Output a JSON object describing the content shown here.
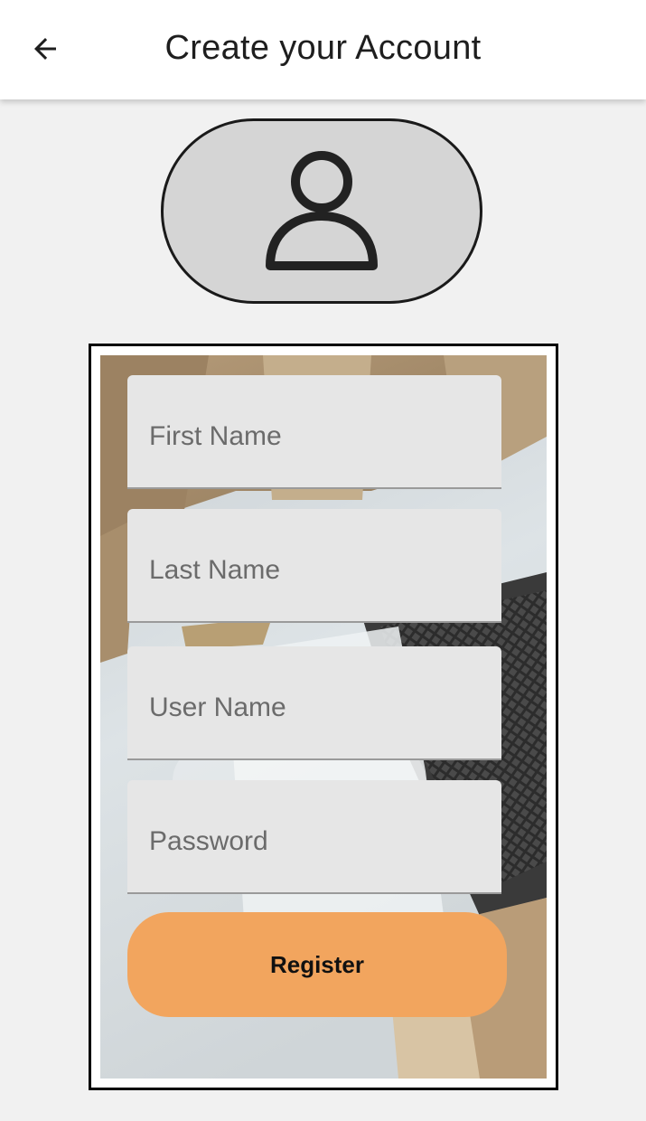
{
  "app_bar": {
    "back_icon": "arrow-left-icon",
    "title": "Create your Account"
  },
  "avatar": {
    "icon": "person-outline-icon"
  },
  "form": {
    "fields": [
      {
        "label": "First Name"
      },
      {
        "label": "Last Name"
      },
      {
        "label": "User Name"
      },
      {
        "label": "Password"
      }
    ],
    "register_label": "Register"
  },
  "colors": {
    "background": "#f1f1f1",
    "app_bar": "#ffffff",
    "avatar_fill": "#d5d5d5",
    "field_fill": "#e6e6e6",
    "button": "#f2a55e",
    "text_dark": "#1e1e1e",
    "placeholder": "#6b6b6b"
  }
}
